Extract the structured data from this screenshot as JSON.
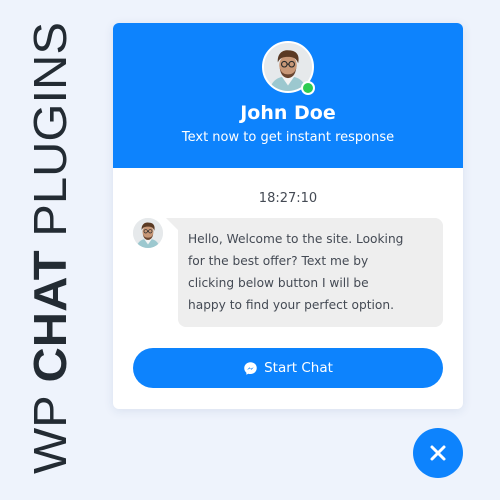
{
  "brand": {
    "part1": "WP ",
    "part2": "CHAT",
    "part3": " PLUGINS"
  },
  "header": {
    "agent_name": "John Doe",
    "subtitle": "Text now to get instant response",
    "status": "online"
  },
  "chat": {
    "timestamp": "18:27:10",
    "message_lines": [
      "Hello, Welcome to the site. Looking",
      "for the best offer? Text me by",
      "clicking below button I will be",
      "happy to find your perfect option."
    ]
  },
  "actions": {
    "start_chat_label": "Start Chat",
    "start_chat_icon": "messenger-icon",
    "close_icon": "close-icon"
  },
  "colors": {
    "accent": "#0d83fd",
    "online": "#2ecc52",
    "bubble": "#eeeeee",
    "background": "#eef3fc"
  }
}
